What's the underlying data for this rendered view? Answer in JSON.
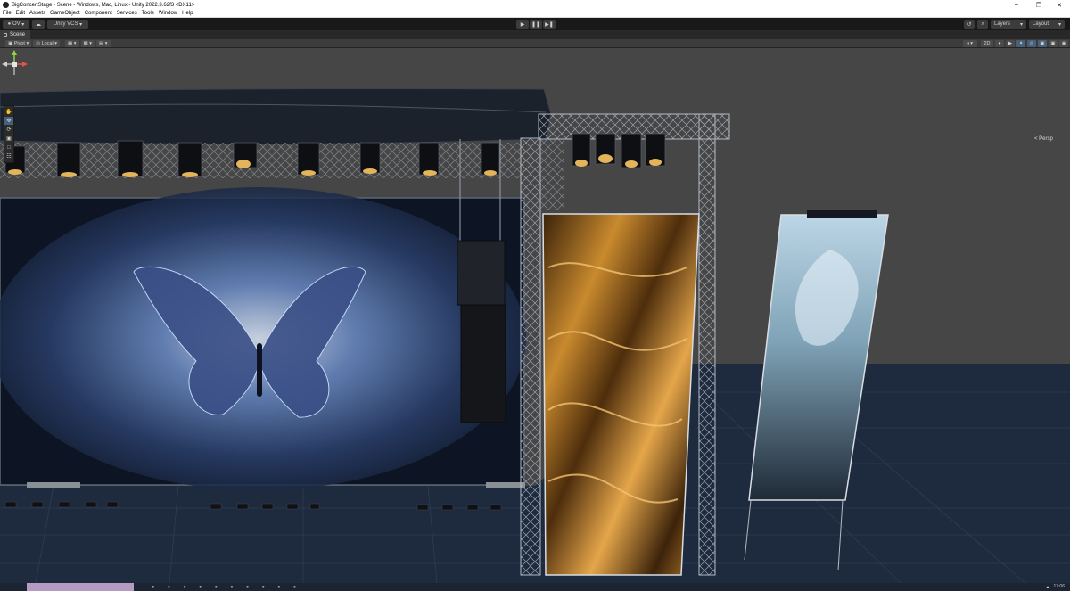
{
  "window": {
    "title": "BigConcertStage - Scene - Windows, Mac, Linux - Unity 2022.3.62f3 <DX11>",
    "controls": [
      "–",
      "❐",
      "✕"
    ]
  },
  "menu": [
    "File",
    "Edit",
    "Assets",
    "GameObject",
    "Component",
    "Services",
    "Tools",
    "Window",
    "Help"
  ],
  "toolbar": {
    "account": "OV",
    "cloud_icon": "cloud-icon",
    "vcs": "Unity VCS",
    "play_icon": "▶",
    "pause_icon": "❚❚",
    "step_icon": "▶❚",
    "history_icon": "↺",
    "search_icon": "⌕",
    "layers": "Layers",
    "layout": "Layout"
  },
  "scene_tab": {
    "label": "Scene"
  },
  "scene_toolbar": {
    "pivot": "Pivot",
    "local": "Local",
    "mode_2d": "2D"
  },
  "orientation": {
    "label": "< Persp"
  },
  "tools": [
    "hand",
    "move",
    "rotate",
    "scale",
    "rect",
    "transform"
  ],
  "taskbar": {
    "clock_time": "17:06"
  },
  "colors": {
    "editor_bg": "#191919",
    "panel": "#3c3c3c",
    "sky": "#464646",
    "ground": "#1e2a3d",
    "accent": "#46607c"
  }
}
